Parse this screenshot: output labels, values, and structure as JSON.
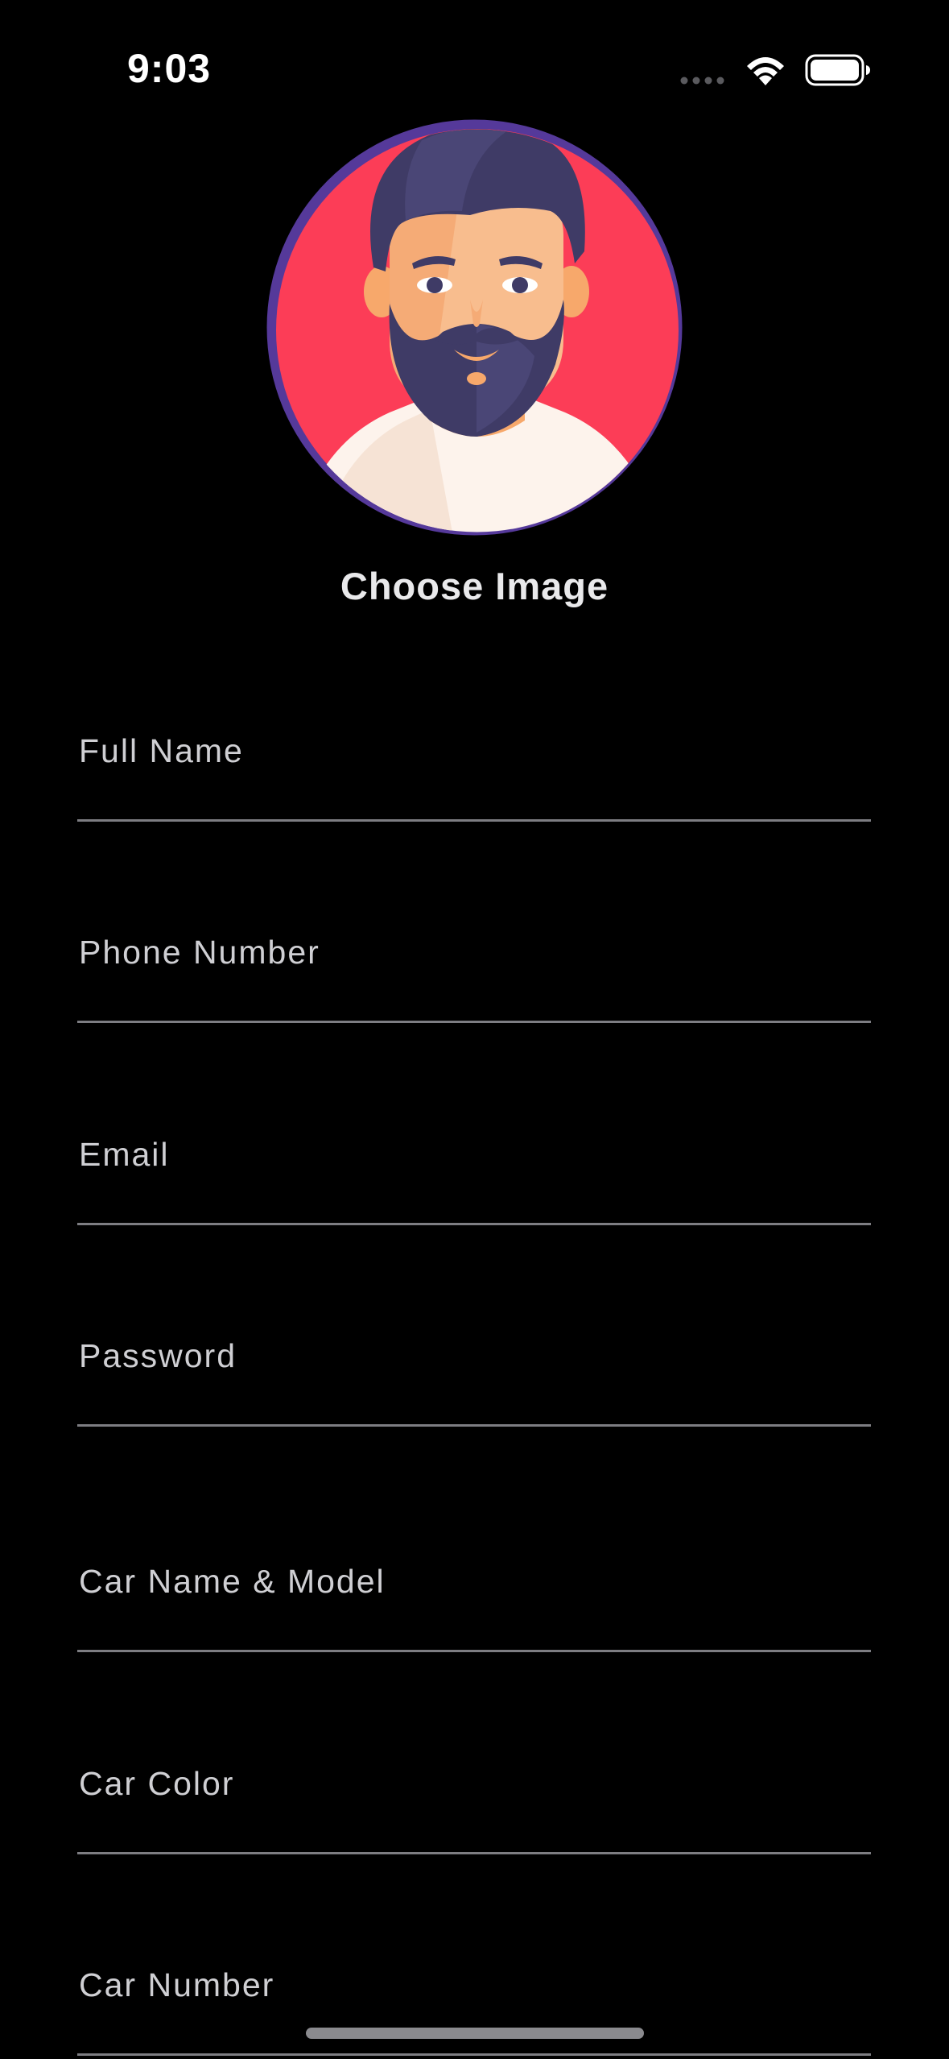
{
  "status_bar": {
    "time": "9:03",
    "icons": [
      "signal-dots-icon",
      "wifi-icon",
      "battery-icon"
    ]
  },
  "avatar": {
    "icon": "bearded-man-avatar",
    "ring_color": "#55399a",
    "background_color": "#fc3d57"
  },
  "choose_image_label": "Choose Image",
  "form": {
    "full_name": {
      "placeholder": "Full Name",
      "value": ""
    },
    "phone_number": {
      "placeholder": "Phone Number",
      "value": ""
    },
    "email": {
      "placeholder": "Email",
      "value": ""
    },
    "password": {
      "placeholder": "Password",
      "value": ""
    },
    "car_name_model": {
      "placeholder": "Car Name & Model",
      "value": ""
    },
    "car_color": {
      "placeholder": "Car Color",
      "value": ""
    },
    "car_number": {
      "placeholder": "Car Number",
      "value": ""
    }
  },
  "colors": {
    "background": "#000000",
    "underline": "#7d7d82",
    "placeholder": "#cfcfd3"
  }
}
